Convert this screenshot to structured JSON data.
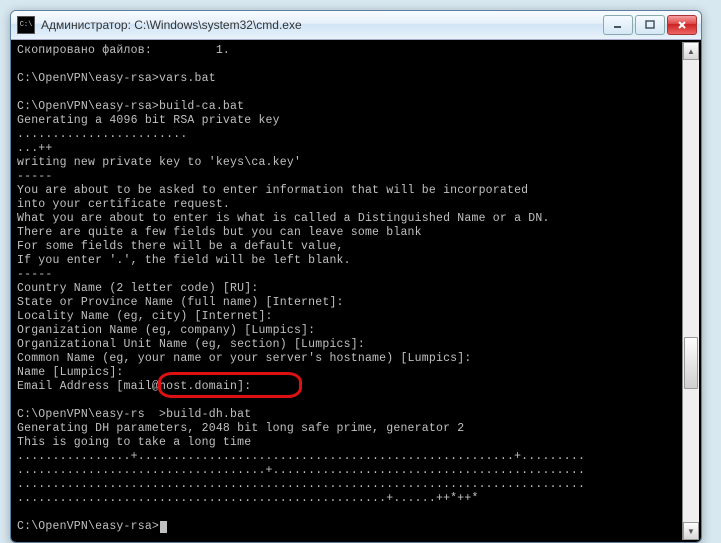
{
  "window": {
    "icon_label": "C:\\",
    "title": "Администратор: C:\\Windows\\system32\\cmd.exe"
  },
  "console": {
    "lines": [
      "Скопировано файлов:         1.",
      "",
      "C:\\OpenVPN\\easy-rsa>vars.bat",
      "",
      "C:\\OpenVPN\\easy-rsa>build-ca.bat",
      "Generating a 4096 bit RSA private key",
      "........................",
      "...++",
      "writing new private key to 'keys\\ca.key'",
      "-----",
      "You are about to be asked to enter information that will be incorporated",
      "into your certificate request.",
      "What you are about to enter is what is called a Distinguished Name or a DN.",
      "There are quite a few fields but you can leave some blank",
      "For some fields there will be a default value,",
      "If you enter '.', the field will be left blank.",
      "-----",
      "Country Name (2 letter code) [RU]:",
      "State or Province Name (full name) [Internet]:",
      "Locality Name (eg, city) [Internet]:",
      "Organization Name (eg, company) [Lumpics]:",
      "Organizational Unit Name (eg, section) [Lumpics]:",
      "Common Name (eg, your name or your server's hostname) [Lumpics]:",
      "Name [Lumpics]:",
      "Email Address [mail@host.domain]:",
      "",
      "C:\\OpenVPN\\easy-rs  >build-dh.bat",
      "Generating DH parameters, 2048 bit long safe prime, generator 2",
      "This is going to take a long time",
      "................+.....................................................+.........",
      "...................................+............................................",
      "................................................................................",
      "....................................................+......++*++*",
      "",
      "C:\\OpenVPN\\easy-rsa>"
    ],
    "highlighted_command": "build-dh.bat"
  }
}
